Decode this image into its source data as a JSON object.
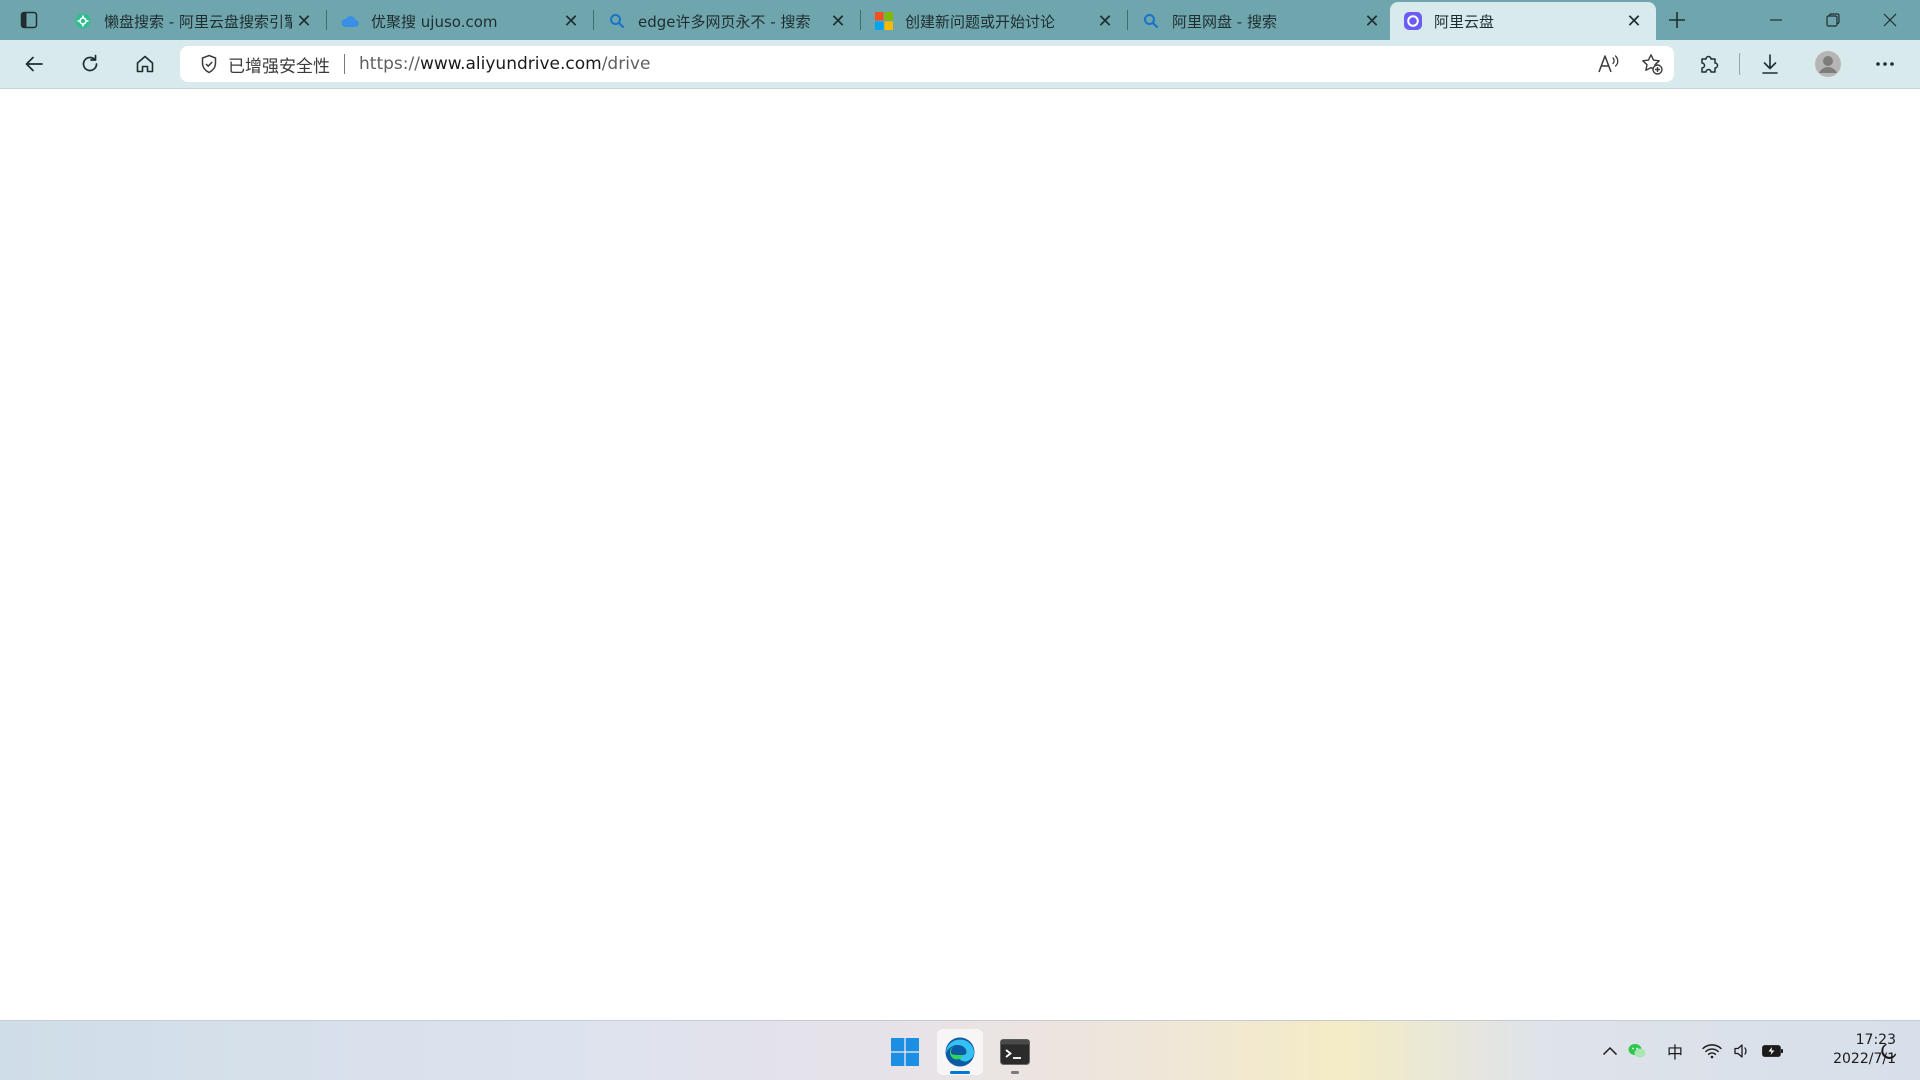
{
  "browser": {
    "tabs": [
      {
        "title": "懒盘搜索 - 阿里云盘搜索引擎",
        "favicon": "gear-icon",
        "active": false
      },
      {
        "title": "优聚搜 ujuso.com",
        "favicon": "cloud-icon",
        "active": false
      },
      {
        "title": "edge许多网页永不 - 搜索",
        "favicon": "search-icon",
        "active": false
      },
      {
        "title": "创建新问题或开始讨论",
        "favicon": "microsoft-logo-icon",
        "active": false
      },
      {
        "title": "阿里网盘 - 搜索",
        "favicon": "search-icon",
        "active": false
      },
      {
        "title": "阿里云盘",
        "favicon": "aliyundrive-icon",
        "active": true
      }
    ],
    "address_bar": {
      "security_label": "已增强安全性",
      "url_prefix": "https://",
      "url_domain": "www.aliyundrive.com",
      "url_path": "/drive"
    },
    "colors": {
      "tabstrip": "#6fa6ae",
      "toolbar": "#d9eaec",
      "accent_blue": "#0078d4"
    }
  },
  "taskbar": {
    "apps": [
      {
        "name": "start-button",
        "icon": "windows-logo-icon"
      },
      {
        "name": "edge",
        "icon": "edge-browser-icon",
        "active": true
      },
      {
        "name": "terminal",
        "icon": "terminal-icon"
      }
    ],
    "tray": {
      "ime": "中",
      "time": "17:23",
      "date": "2022/7/1"
    }
  }
}
